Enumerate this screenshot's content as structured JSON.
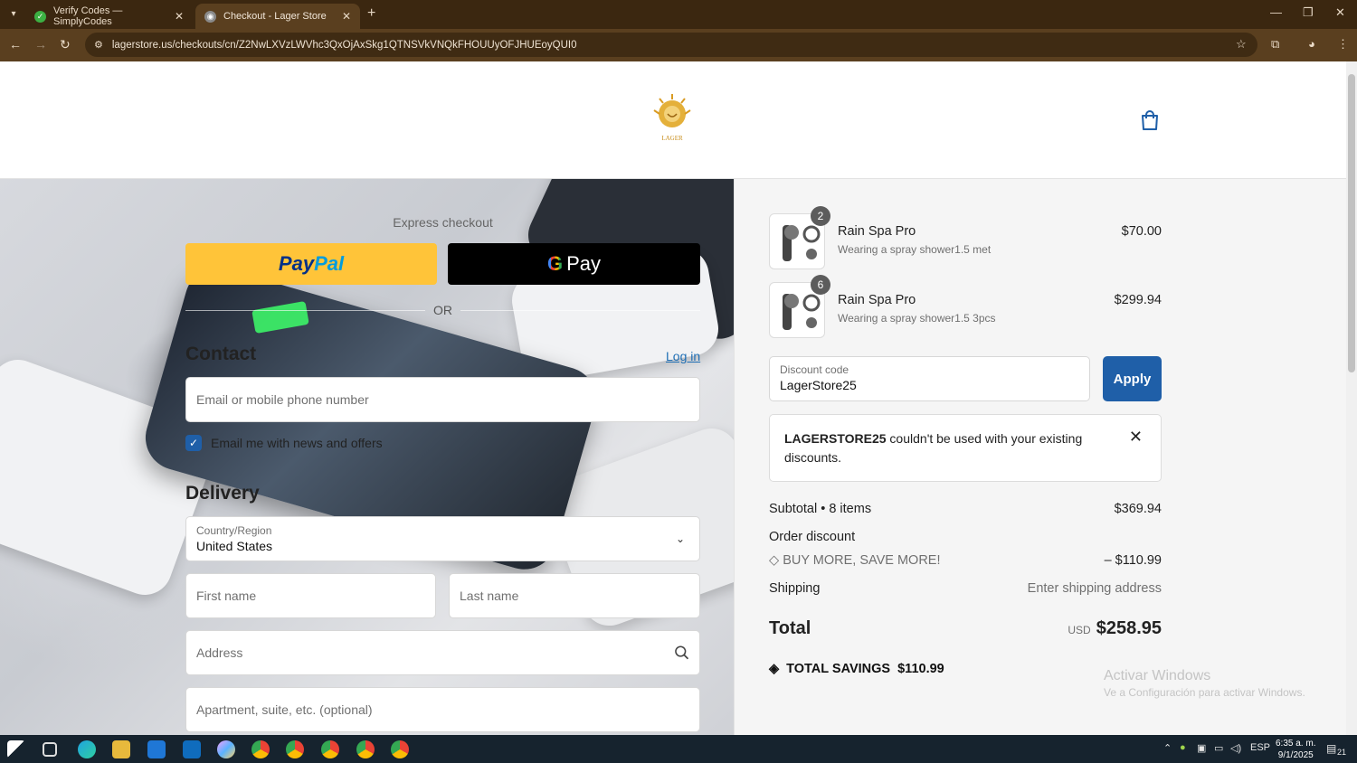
{
  "browser": {
    "tabs": [
      {
        "title": "Verify Codes — SimplyCodes",
        "active": false
      },
      {
        "title": "Checkout - Lager Store",
        "active": true
      }
    ],
    "url": "lagerstore.us/checkouts/cn/Z2NwLXVzLWVhc3QxOjAxSkg1QTNSVkVNQkFHOUUyOFJHUEoyQUI0"
  },
  "header": {
    "logo_text": "LAGER",
    "cart_icon": "shopping-bag-icon"
  },
  "checkout": {
    "express_label": "Express checkout",
    "paypal_label_1": "Pay",
    "paypal_label_2": "Pal",
    "gpay_label": "Pay",
    "or_label": "OR",
    "contact_heading": "Contact",
    "login_link": "Log in",
    "email_placeholder": "Email or mobile phone number",
    "newsletter_label": "Email me with news and offers",
    "newsletter_checked": true,
    "delivery_heading": "Delivery",
    "country_label": "Country/Region",
    "country_value": "United States",
    "first_name_placeholder": "First name",
    "last_name_placeholder": "Last name",
    "address_placeholder": "Address",
    "apartment_placeholder": "Apartment, suite, etc. (optional)"
  },
  "summary": {
    "items": [
      {
        "qty": "2",
        "name": "Rain Spa Pro",
        "variant": "Wearing a spray shower1.5 met",
        "price": "$70.00"
      },
      {
        "qty": "6",
        "name": "Rain Spa Pro",
        "variant": "Wearing a spray shower1.5 3pcs",
        "price": "$299.94"
      }
    ],
    "discount_label": "Discount code",
    "discount_value": "LagerStore25",
    "apply_label": "Apply",
    "error_code": "LAGERSTORE25",
    "error_message": " couldn't be used with your existing discounts.",
    "subtotal_label": "Subtotal • 8 items",
    "subtotal_value": "$369.94",
    "order_discount_label": "Order discount",
    "promo_label": "BUY MORE, SAVE MORE!",
    "promo_value": "– $110.99",
    "shipping_label": "Shipping",
    "shipping_value": "Enter shipping address",
    "total_label": "Total",
    "total_currency": "USD",
    "total_value": "$258.95",
    "savings_label": "TOTAL SAVINGS",
    "savings_value": "$110.99"
  },
  "watermark": {
    "line1": "Activar Windows",
    "line2": "Ve a Configuración para activar Windows."
  },
  "taskbar": {
    "language": "ESP",
    "time": "6:35 a. m.",
    "date": "9/1/2025",
    "notifications": "21"
  },
  "colors": {
    "accent": "#1f5fa8",
    "paypal": "#ffc439",
    "chrome": "#3b2710"
  }
}
